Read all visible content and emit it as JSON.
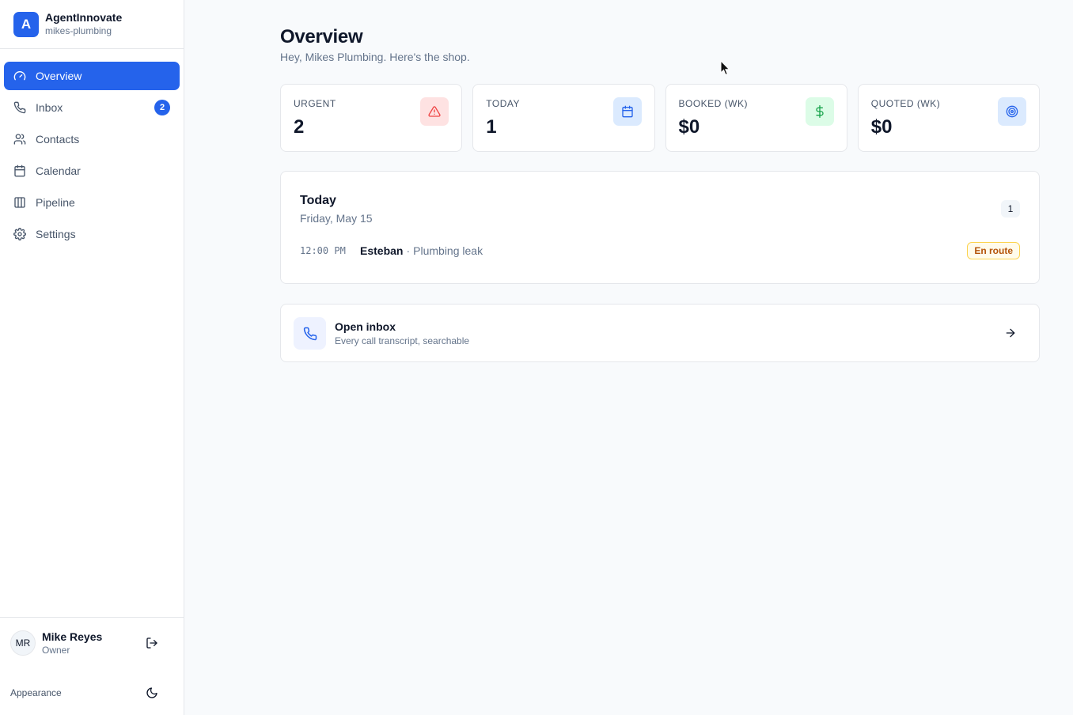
{
  "brand": {
    "logo_letter": "A",
    "name": "AgentInnovate",
    "slug": "mikes-plumbing",
    "color": "#2563eb"
  },
  "nav": {
    "items": [
      {
        "label": "Overview",
        "icon": "gauge-icon",
        "active": true
      },
      {
        "label": "Inbox",
        "icon": "phone-icon",
        "badge": "2"
      },
      {
        "label": "Contacts",
        "icon": "users-icon"
      },
      {
        "label": "Calendar",
        "icon": "calendar-icon"
      },
      {
        "label": "Pipeline",
        "icon": "columns-icon"
      },
      {
        "label": "Settings",
        "icon": "gear-icon"
      }
    ]
  },
  "user": {
    "initials": "MR",
    "name": "Mike Reyes",
    "role": "Owner"
  },
  "appearance": {
    "label": "Appearance"
  },
  "page": {
    "title": "Overview",
    "subtitle": "Hey, Mikes Plumbing. Here's the shop."
  },
  "stats": [
    {
      "label": "URGENT",
      "value": "2",
      "icon": "alert-triangle-icon",
      "color": "#ef4444",
      "bg": "#fee2e2"
    },
    {
      "label": "TODAY",
      "value": "1",
      "icon": "calendar-icon",
      "color": "#2563eb",
      "bg": "#dbeafe"
    },
    {
      "label": "BOOKED (WK)",
      "value": "$0",
      "icon": "dollar-icon",
      "color": "#16a34a",
      "bg": "#dcfce7"
    },
    {
      "label": "QUOTED (WK)",
      "value": "$0",
      "icon": "target-icon",
      "color": "#2563eb",
      "bg": "#dbeafe"
    }
  ],
  "today": {
    "title": "Today",
    "date": "Friday, May 15",
    "count": "1",
    "appointments": [
      {
        "time": "12:00 PM",
        "name": "Esteban",
        "separator": "·",
        "description": "Plumbing leak",
        "status": "En route"
      }
    ]
  },
  "inbox_card": {
    "title": "Open inbox",
    "subtitle": "Every call transcript, searchable"
  }
}
